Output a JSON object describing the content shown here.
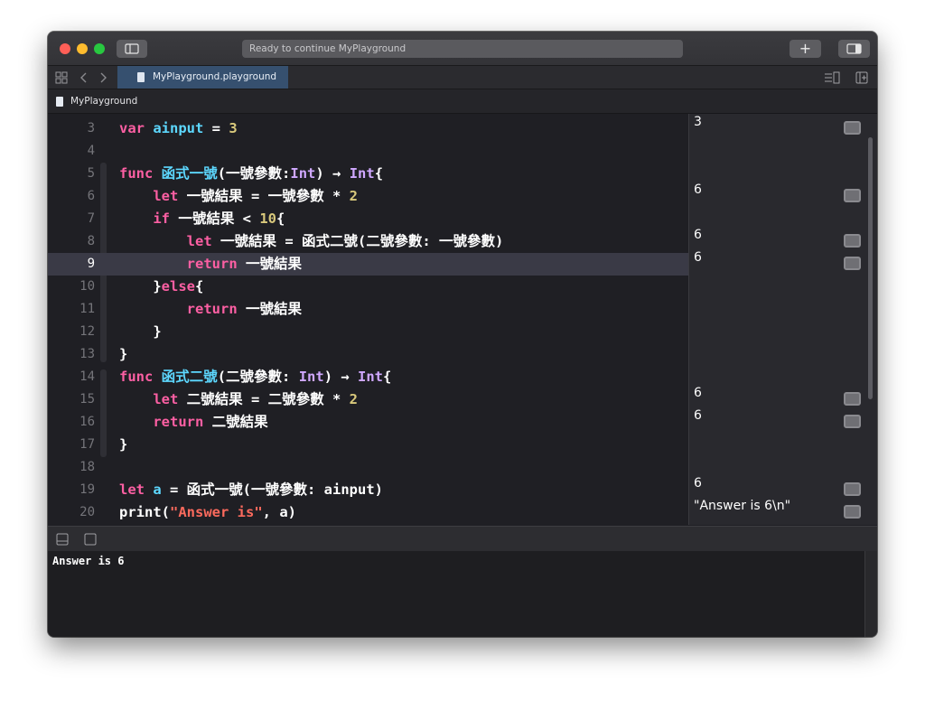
{
  "window": {
    "status_text": "Ready to continue MyPlayground",
    "add_label": "+"
  },
  "tab": {
    "title": "MyPlayground.playground"
  },
  "jumpbar": {
    "path": "MyPlayground"
  },
  "editor": {
    "lines": [
      {
        "num": "3",
        "tokens": [
          [
            "kw",
            "var"
          ],
          [
            "p",
            " "
          ],
          [
            "id",
            "ainput"
          ],
          [
            "p",
            " = "
          ],
          [
            "num",
            "3"
          ]
        ]
      },
      {
        "num": "4",
        "tokens": []
      },
      {
        "num": "5",
        "tokens": [
          [
            "kw",
            "func"
          ],
          [
            "p",
            " "
          ],
          [
            "id",
            "函式一號"
          ],
          [
            "p",
            "(一號參數:"
          ],
          [
            "ty",
            "Int"
          ],
          [
            "p",
            ") → "
          ],
          [
            "ty",
            "Int"
          ],
          [
            "p",
            "{"
          ]
        ]
      },
      {
        "num": "6",
        "tokens": [
          [
            "p",
            "    "
          ],
          [
            "kw",
            "let"
          ],
          [
            "p",
            " 一號結果 = 一號參數 * "
          ],
          [
            "num",
            "2"
          ]
        ]
      },
      {
        "num": "7",
        "tokens": [
          [
            "p",
            "    "
          ],
          [
            "kw",
            "if"
          ],
          [
            "p",
            " 一號結果 < "
          ],
          [
            "num",
            "10"
          ],
          [
            "p",
            "{"
          ]
        ]
      },
      {
        "num": "8",
        "tokens": [
          [
            "p",
            "        "
          ],
          [
            "kw",
            "let"
          ],
          [
            "p",
            " 一號結果 = 函式二號(二號參數: 一號參數)"
          ]
        ]
      },
      {
        "num": "9",
        "tokens": [
          [
            "p",
            "        "
          ],
          [
            "kw",
            "return"
          ],
          [
            "p",
            " 一號結果"
          ]
        ]
      },
      {
        "num": "10",
        "tokens": [
          [
            "p",
            "    }"
          ],
          [
            "kw",
            "else"
          ],
          [
            "p",
            "{"
          ]
        ]
      },
      {
        "num": "11",
        "tokens": [
          [
            "p",
            "        "
          ],
          [
            "kw",
            "return"
          ],
          [
            "p",
            " 一號結果"
          ]
        ]
      },
      {
        "num": "12",
        "tokens": [
          [
            "p",
            "    }"
          ]
        ]
      },
      {
        "num": "13",
        "tokens": [
          [
            "p",
            "}"
          ]
        ]
      },
      {
        "num": "14",
        "tokens": [
          [
            "kw",
            "func"
          ],
          [
            "p",
            " "
          ],
          [
            "id",
            "函式二號"
          ],
          [
            "p",
            "(二號參數: "
          ],
          [
            "ty",
            "Int"
          ],
          [
            "p",
            ") → "
          ],
          [
            "ty",
            "Int"
          ],
          [
            "p",
            "{"
          ]
        ]
      },
      {
        "num": "15",
        "tokens": [
          [
            "p",
            "    "
          ],
          [
            "kw",
            "let"
          ],
          [
            "p",
            " 二號結果 = 二號參數 * "
          ],
          [
            "num",
            "2"
          ]
        ]
      },
      {
        "num": "16",
        "tokens": [
          [
            "p",
            "    "
          ],
          [
            "kw",
            "return"
          ],
          [
            "p",
            " 二號結果"
          ]
        ]
      },
      {
        "num": "17",
        "tokens": [
          [
            "p",
            "}"
          ]
        ]
      },
      {
        "num": "18",
        "tokens": []
      },
      {
        "num": "19",
        "tokens": [
          [
            "kw",
            "let"
          ],
          [
            "p",
            " "
          ],
          [
            "id",
            "a"
          ],
          [
            "p",
            " = 函式一號(一號參數: ainput)"
          ]
        ]
      },
      {
        "num": "20",
        "tokens": [
          [
            "p",
            "print("
          ],
          [
            "str",
            "\"Answer is\""
          ],
          [
            "p",
            ", a)"
          ]
        ]
      }
    ],
    "highlighted_line": "9"
  },
  "results": [
    {
      "line": "3",
      "value": "3"
    },
    {
      "line": "6",
      "value": "6"
    },
    {
      "line": "8",
      "value": "6"
    },
    {
      "line": "9",
      "value": "6"
    },
    {
      "line": "15",
      "value": "6"
    },
    {
      "line": "16",
      "value": "6"
    },
    {
      "line": "19",
      "value": "6"
    },
    {
      "line": "20",
      "value": "\"Answer is 6\\n\""
    }
  ],
  "console": {
    "output": "Answer is 6"
  },
  "colors": {
    "keyword": "#fc5fa3",
    "identifier": "#5dd8ff",
    "number": "#d9c97c",
    "string": "#fc6a5d",
    "type": "#d0a8ff",
    "tab_active": "#36506f"
  },
  "icons": [
    "close-light",
    "minimize-light",
    "zoom-light",
    "sidebar-toggle-icon",
    "add-icon",
    "inspector-toggle-icon",
    "grid-icon",
    "back-arrow-icon",
    "forward-arrow-icon",
    "file-icon",
    "editor-options-icon",
    "add-editor-icon",
    "quick-look-icon",
    "hide-debug-icon",
    "debug-area-icon"
  ]
}
